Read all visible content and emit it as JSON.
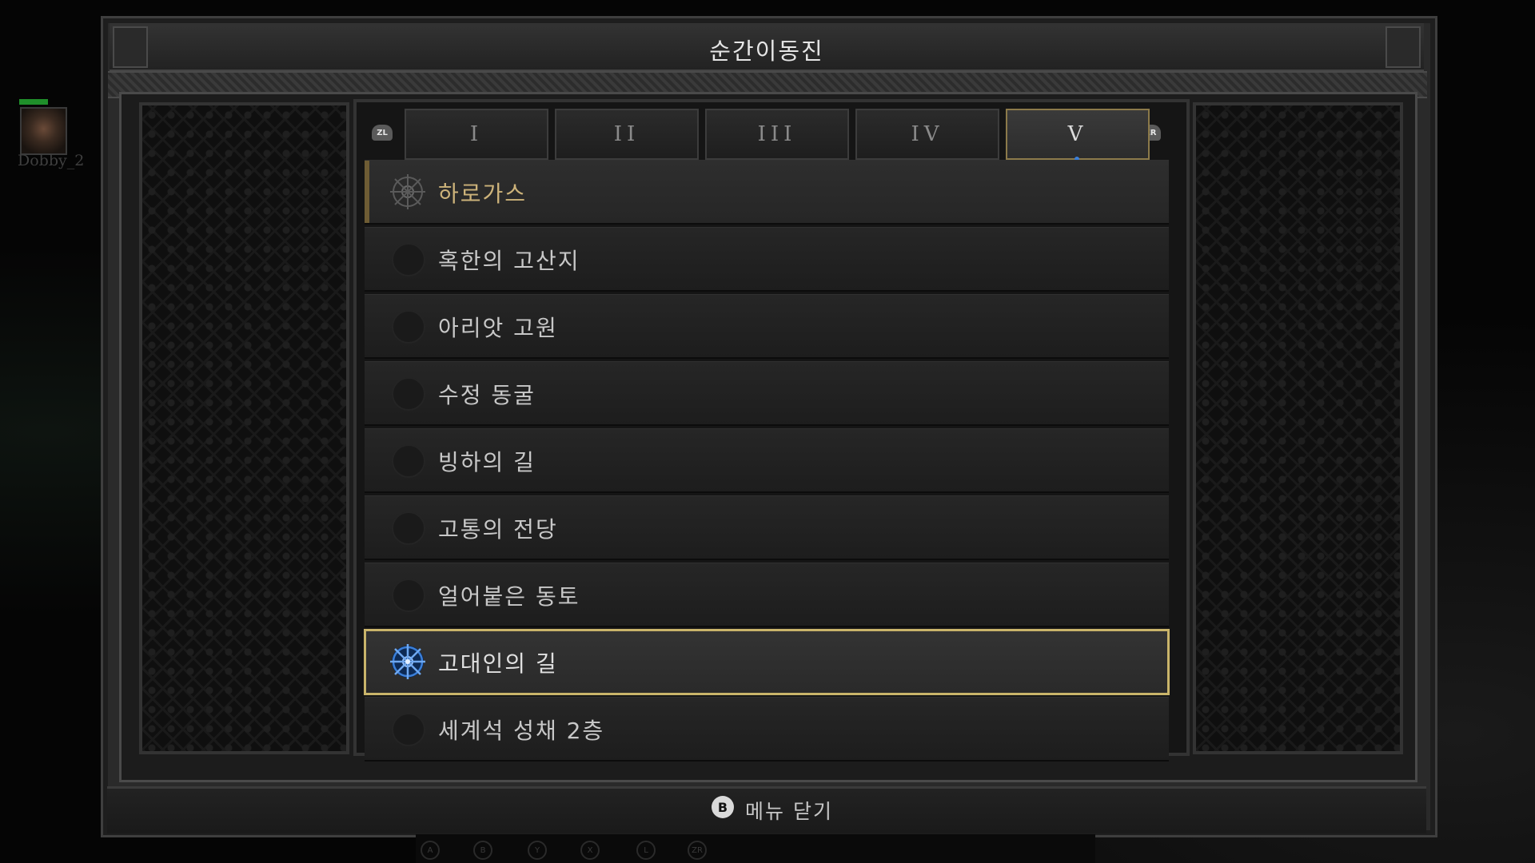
{
  "window": {
    "title": "순간이동진"
  },
  "party": {
    "member_name": "Dobby_2"
  },
  "shoulder_buttons": {
    "left": "ZL",
    "right": "ZR"
  },
  "tabs": [
    {
      "label": "I",
      "active": false
    },
    {
      "label": "II",
      "active": false
    },
    {
      "label": "III",
      "active": false
    },
    {
      "label": "IV",
      "active": false
    },
    {
      "label": "V",
      "active": true
    }
  ],
  "waypoints": [
    {
      "label": "하로가스",
      "type": "town",
      "activated": true,
      "selected": false
    },
    {
      "label": "혹한의 고산지",
      "type": "area",
      "activated": false,
      "selected": false
    },
    {
      "label": "아리앗 고원",
      "type": "area",
      "activated": false,
      "selected": false
    },
    {
      "label": "수정 동굴",
      "type": "area",
      "activated": false,
      "selected": false
    },
    {
      "label": "빙하의 길",
      "type": "area",
      "activated": false,
      "selected": false
    },
    {
      "label": "고통의 전당",
      "type": "area",
      "activated": false,
      "selected": false
    },
    {
      "label": "얼어붙은 동토",
      "type": "area",
      "activated": false,
      "selected": false
    },
    {
      "label": "고대인의 길",
      "type": "area",
      "activated": true,
      "selected": true
    },
    {
      "label": "세계석 성채 2층",
      "type": "area",
      "activated": false,
      "selected": false
    }
  ],
  "footer": {
    "button_glyph": "B",
    "close_label": "메뉴 닫기"
  },
  "hotbar_keys": [
    "A",
    "B",
    "Y",
    "X",
    "L",
    "ZR"
  ],
  "colors": {
    "selected_outline": "#c9b46a",
    "town_label": "#cdb37a",
    "waypoint_active_blue": "#3b7fd8"
  },
  "icons": {
    "waypoint_active": "waypoint-rune-icon",
    "waypoint_inactive": "empty-slot-icon"
  }
}
